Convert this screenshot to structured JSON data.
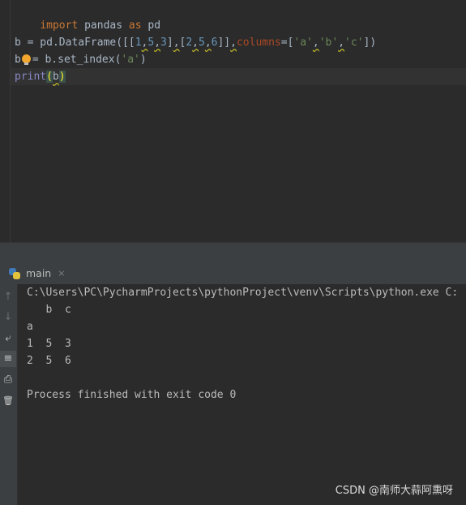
{
  "editor": {
    "lines": {
      "l1": {
        "import": "import",
        "mod": " pandas ",
        "as": "as",
        "alias": " pd"
      },
      "l3": {
        "a": "b = pd.DataFrame([[",
        "n1": "1",
        "c1": ",",
        "n2": "5",
        "c2": ",",
        "n3": "3",
        "b": "]",
        "c3": ",",
        "d": "[",
        "n4": "2",
        "c4": ",",
        "n5": "5",
        "c5": ",",
        "n6": "6",
        "e": "]]",
        "c6": ",",
        "param": "columns",
        "f": "=[",
        "s1": "'a'",
        "c7": ",",
        "s2": "'b'",
        "c8": ",",
        "s3": "'c'",
        "g": "])"
      },
      "l4": {
        "a": "b",
        "b": "= b.set_index(",
        "s": "'a'",
        "c": ")"
      },
      "l5": {
        "fn": "print",
        "open": "(",
        "arg": "b",
        "close": ")"
      }
    }
  },
  "run": {
    "tab_label": "main",
    "tab_close": "×",
    "toolbar": {
      "rerun": "↑",
      "stop": "↓",
      "wrap": "⤶",
      "scroll": "≡",
      "print": "⎙",
      "clear": "🗑"
    },
    "console": {
      "cmd": "C:\\Users\\PC\\PycharmProjects\\pythonProject\\venv\\Scripts\\python.exe C:",
      "out1": "   b  c",
      "out2": "a",
      "out3": "1  5  3",
      "out4": "2  5  6",
      "exit": "Process finished with exit code 0"
    }
  },
  "watermark": "CSDN @南师大蒜阿熏呀"
}
